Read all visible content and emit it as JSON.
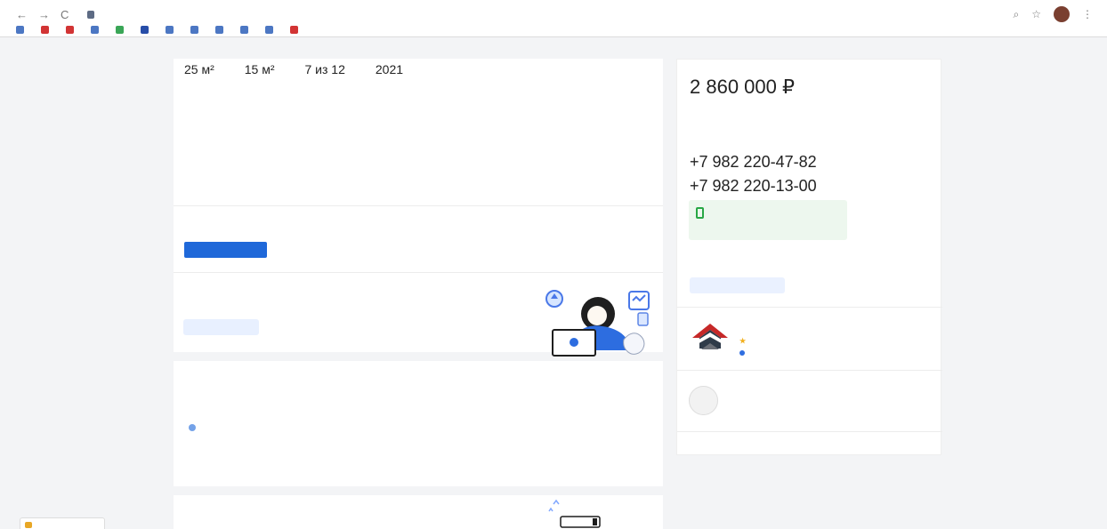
{
  "browser": {
    "url": "",
    "nav": [
      "←",
      "→",
      "C"
    ],
    "right_icons": [
      "⌕",
      "☆",
      "⋮"
    ],
    "bookmarks": [
      "",
      "",
      "",
      "",
      "",
      "",
      "",
      "",
      "",
      "",
      "",
      ""
    ],
    "reading_list": ""
  },
  "listing": {
    "facts": [
      {
        "value": "25 м²",
        "label": ""
      },
      {
        "value": "15 м²",
        "label": ""
      },
      {
        "value": "7 из 12",
        "label": ""
      },
      {
        "value": "2021",
        "label": ""
      }
    ],
    "description": "",
    "notice": "",
    "show_phone": "",
    "help": {
      "title": "",
      "text": "",
      "button": ""
    }
  },
  "info": {
    "title": "",
    "rows": [
      {
        "label": "",
        "value": ""
      },
      {
        "label": "",
        "value": ""
      },
      {
        "label": "",
        "value": ""
      },
      {
        "label": "",
        "value": ""
      }
    ]
  },
  "bottom": {
    "title": ""
  },
  "sidebar": {
    "price": "2 860 000 ₽",
    "price_note": "",
    "mortgage_link": "",
    "contact_note": "",
    "phones": [
      "+7 982 220-47-82",
      "+7 982 220-13-00"
    ],
    "message_box": {
      "title": "",
      "subtitle": "",
      "status": ""
    },
    "small_text": "",
    "write_button": "",
    "agency": {
      "caption": "",
      "name": "",
      "verified": ""
    },
    "agent": {
      "label": "",
      "name": ""
    }
  },
  "widget": {
    "label": ""
  },
  "colors": {
    "accent": "#1f68d9",
    "success": "#28a745",
    "agency_red": "#c62828"
  }
}
